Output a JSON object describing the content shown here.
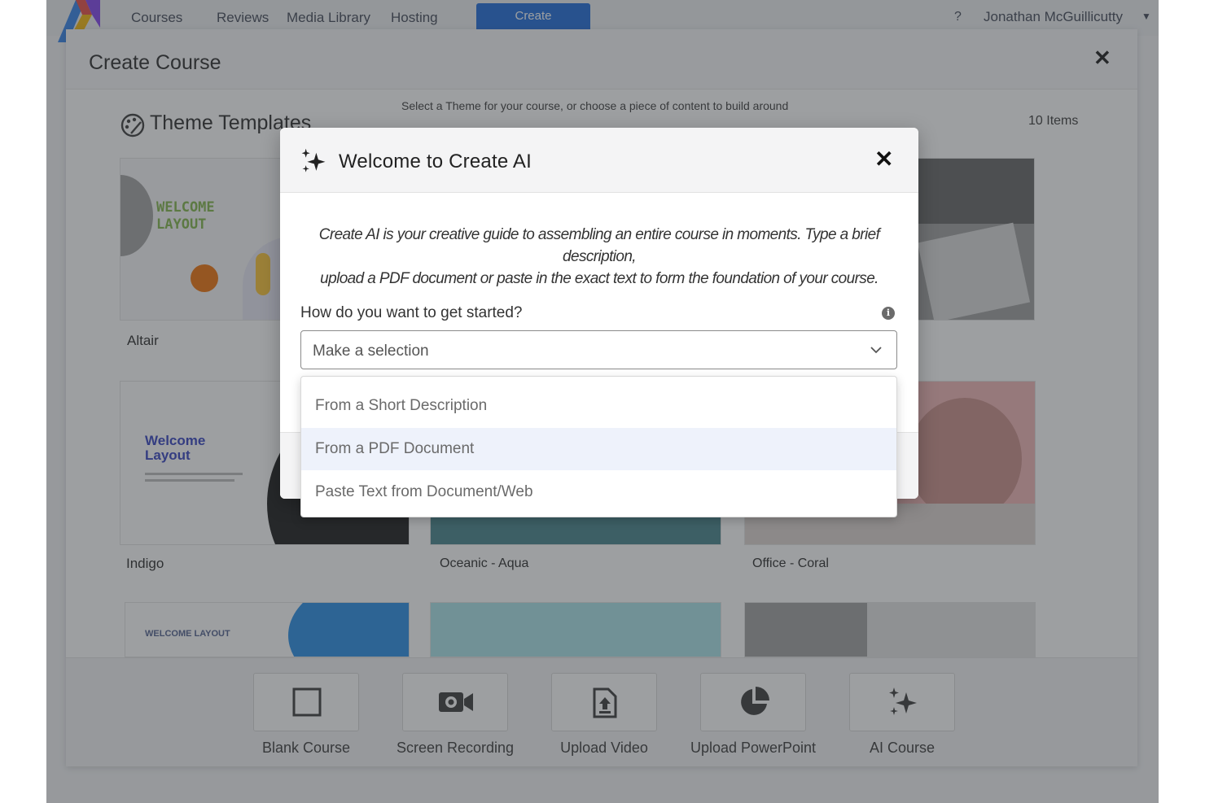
{
  "nav": {
    "items": [
      "Courses",
      "Reviews",
      "Media Library",
      "Hosting"
    ],
    "create_label": "Create",
    "help": "?",
    "user_name": "Jonathan McGuillicutty"
  },
  "panel": {
    "title": "Create Course",
    "subtitle": "Select a Theme for your course, or choose a piece of content to build around",
    "section_title": "Theme Templates",
    "items_count": "10 Items",
    "themes": [
      "Altair",
      "Indigo",
      "Oceanic - Aqua",
      "Office - Coral"
    ],
    "thumb_text": {
      "altair_line1": "WELCOME",
      "altair_line2": "LAYOUT",
      "indigo_line1": "Welcome",
      "indigo_line2": "Layout",
      "row3_a": "WELCOME LAYOUT"
    }
  },
  "toolbar": {
    "items": [
      {
        "label": "Blank Course",
        "icon": "square-icon"
      },
      {
        "label": "Screen Recording",
        "icon": "video-camera-icon"
      },
      {
        "label": "Upload Video",
        "icon": "file-upload-icon"
      },
      {
        "label": "Upload PowerPoint",
        "icon": "pie-chart-icon"
      },
      {
        "label": "AI Course",
        "icon": "sparkle-icon"
      }
    ]
  },
  "modal": {
    "title": "Welcome to Create AI",
    "description_line1": "Create AI is your creative guide to assembling an entire course in moments. Type a brief description,",
    "description_line2": "upload a PDF document or paste in the exact text to form the foundation of your course.",
    "question": "How do you want to get started?",
    "select_placeholder": "Make a selection",
    "options": [
      "From a Short Description",
      "From a PDF Document",
      "Paste Text from Document/Web"
    ],
    "highlighted_option": 1
  },
  "colors": {
    "brand_blue": "#1565d8",
    "overlay": "#3c3f44",
    "indigo_text": "#2d3bbf"
  }
}
